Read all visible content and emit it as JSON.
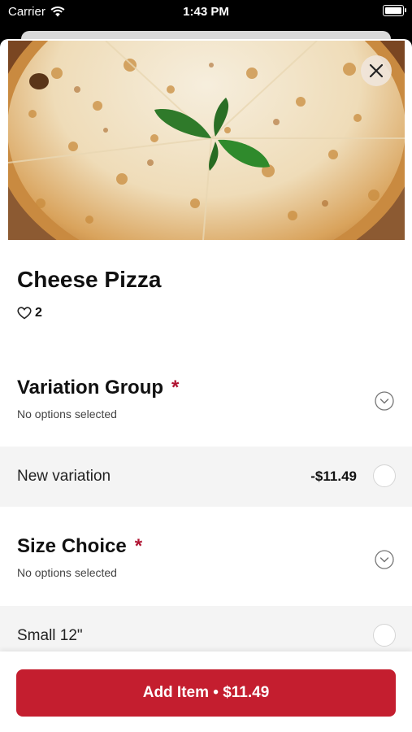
{
  "status_bar": {
    "carrier": "Carrier",
    "time": "1:43 PM"
  },
  "item": {
    "title": "Cheese Pizza",
    "likes": "2"
  },
  "colors": {
    "accent": "#c41e2f",
    "required": "#b01432",
    "option_bg": "#f4f4f4"
  },
  "groups": [
    {
      "title": "Variation Group",
      "required_mark": "*",
      "subtitle": "No options selected",
      "options": [
        {
          "label": "New variation",
          "price": "-$11.49"
        }
      ]
    },
    {
      "title": "Size Choice",
      "required_mark": "*",
      "subtitle": "No options selected",
      "options": [
        {
          "label": "Small 12\"",
          "price": ""
        }
      ]
    }
  ],
  "footer": {
    "add_button_label": "Add Item • $11.49"
  },
  "icons": {
    "close": "close-icon",
    "heart": "heart-icon",
    "chevron": "chevron-down-icon",
    "wifi": "wifi-icon",
    "battery": "battery-icon"
  }
}
